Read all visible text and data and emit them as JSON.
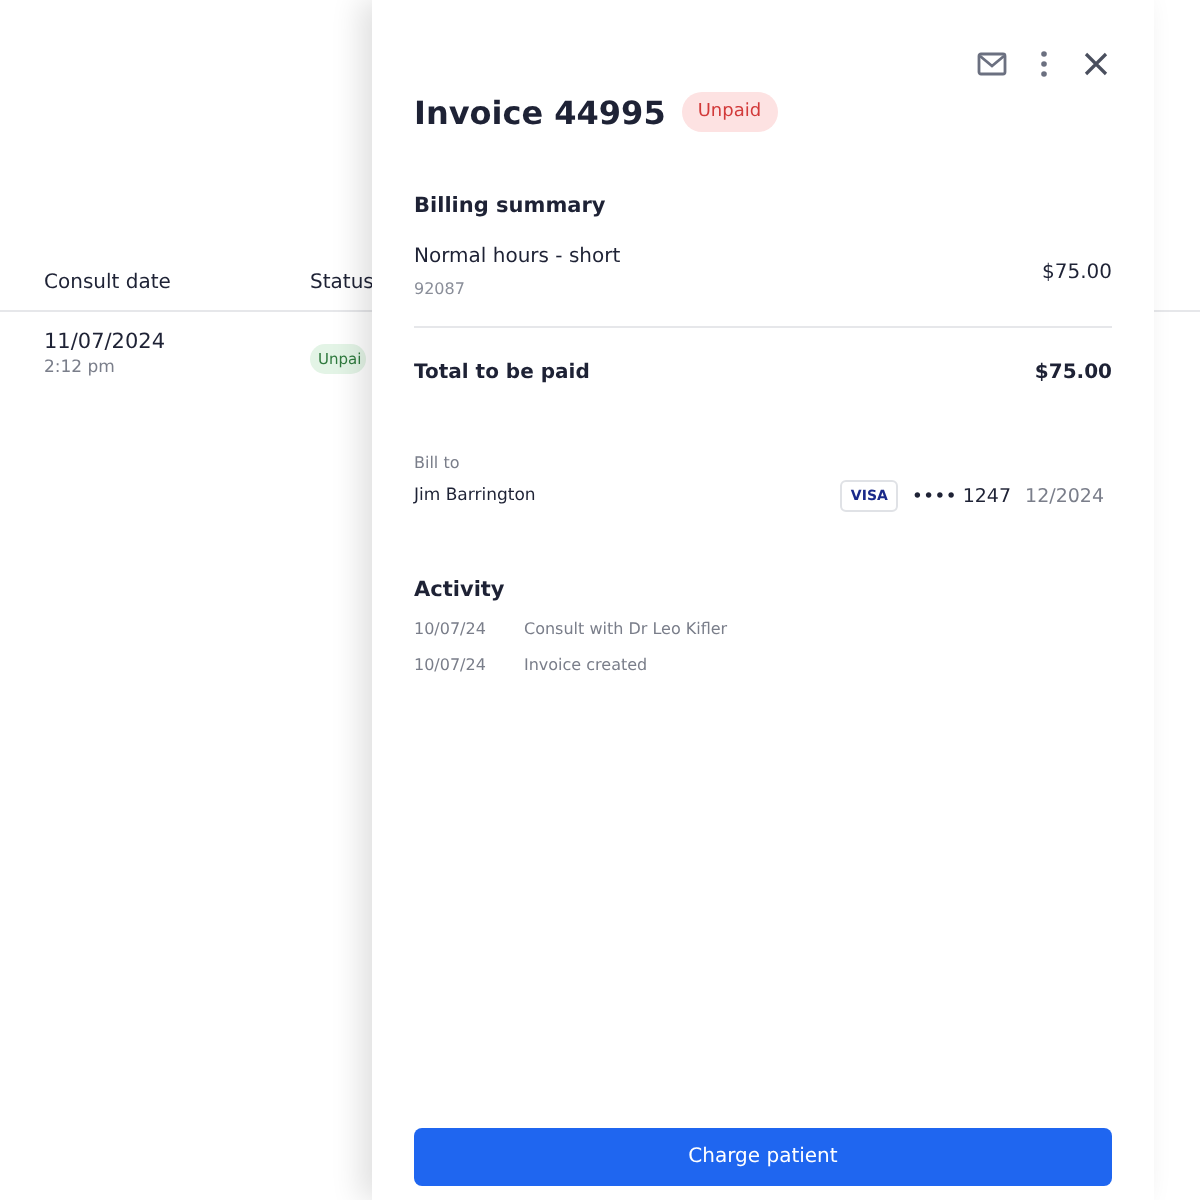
{
  "table": {
    "columns": [
      "Consult date",
      "Status"
    ],
    "rows": [
      {
        "date": "11/07/2024",
        "time": "2:12 pm",
        "status": {
          "label": "Unpai",
          "kind": "success"
        }
      }
    ]
  },
  "invoice": {
    "title": "Invoice 44995",
    "status": {
      "label": "Unpaid",
      "kind": "danger"
    },
    "billing_summary": {
      "heading": "Billing summary",
      "items": [
        {
          "name": "Normal hours - short",
          "code": "92087",
          "amount": "$75.00"
        }
      ],
      "total_label": "Total to be paid",
      "total_amount": "$75.00"
    },
    "bill_to": {
      "label": "Bill to",
      "name": "Jim Barrington",
      "card_brand": "VISA",
      "card_number": "•••• 1247",
      "card_expiry": "12/2024"
    },
    "activity": {
      "heading": "Activity",
      "entries": [
        {
          "date": "10/07/24",
          "text": "Consult with Dr Leo Kifler"
        },
        {
          "date": "10/07/24",
          "text": "Invoice created"
        }
      ]
    },
    "button": "Charge patient"
  }
}
